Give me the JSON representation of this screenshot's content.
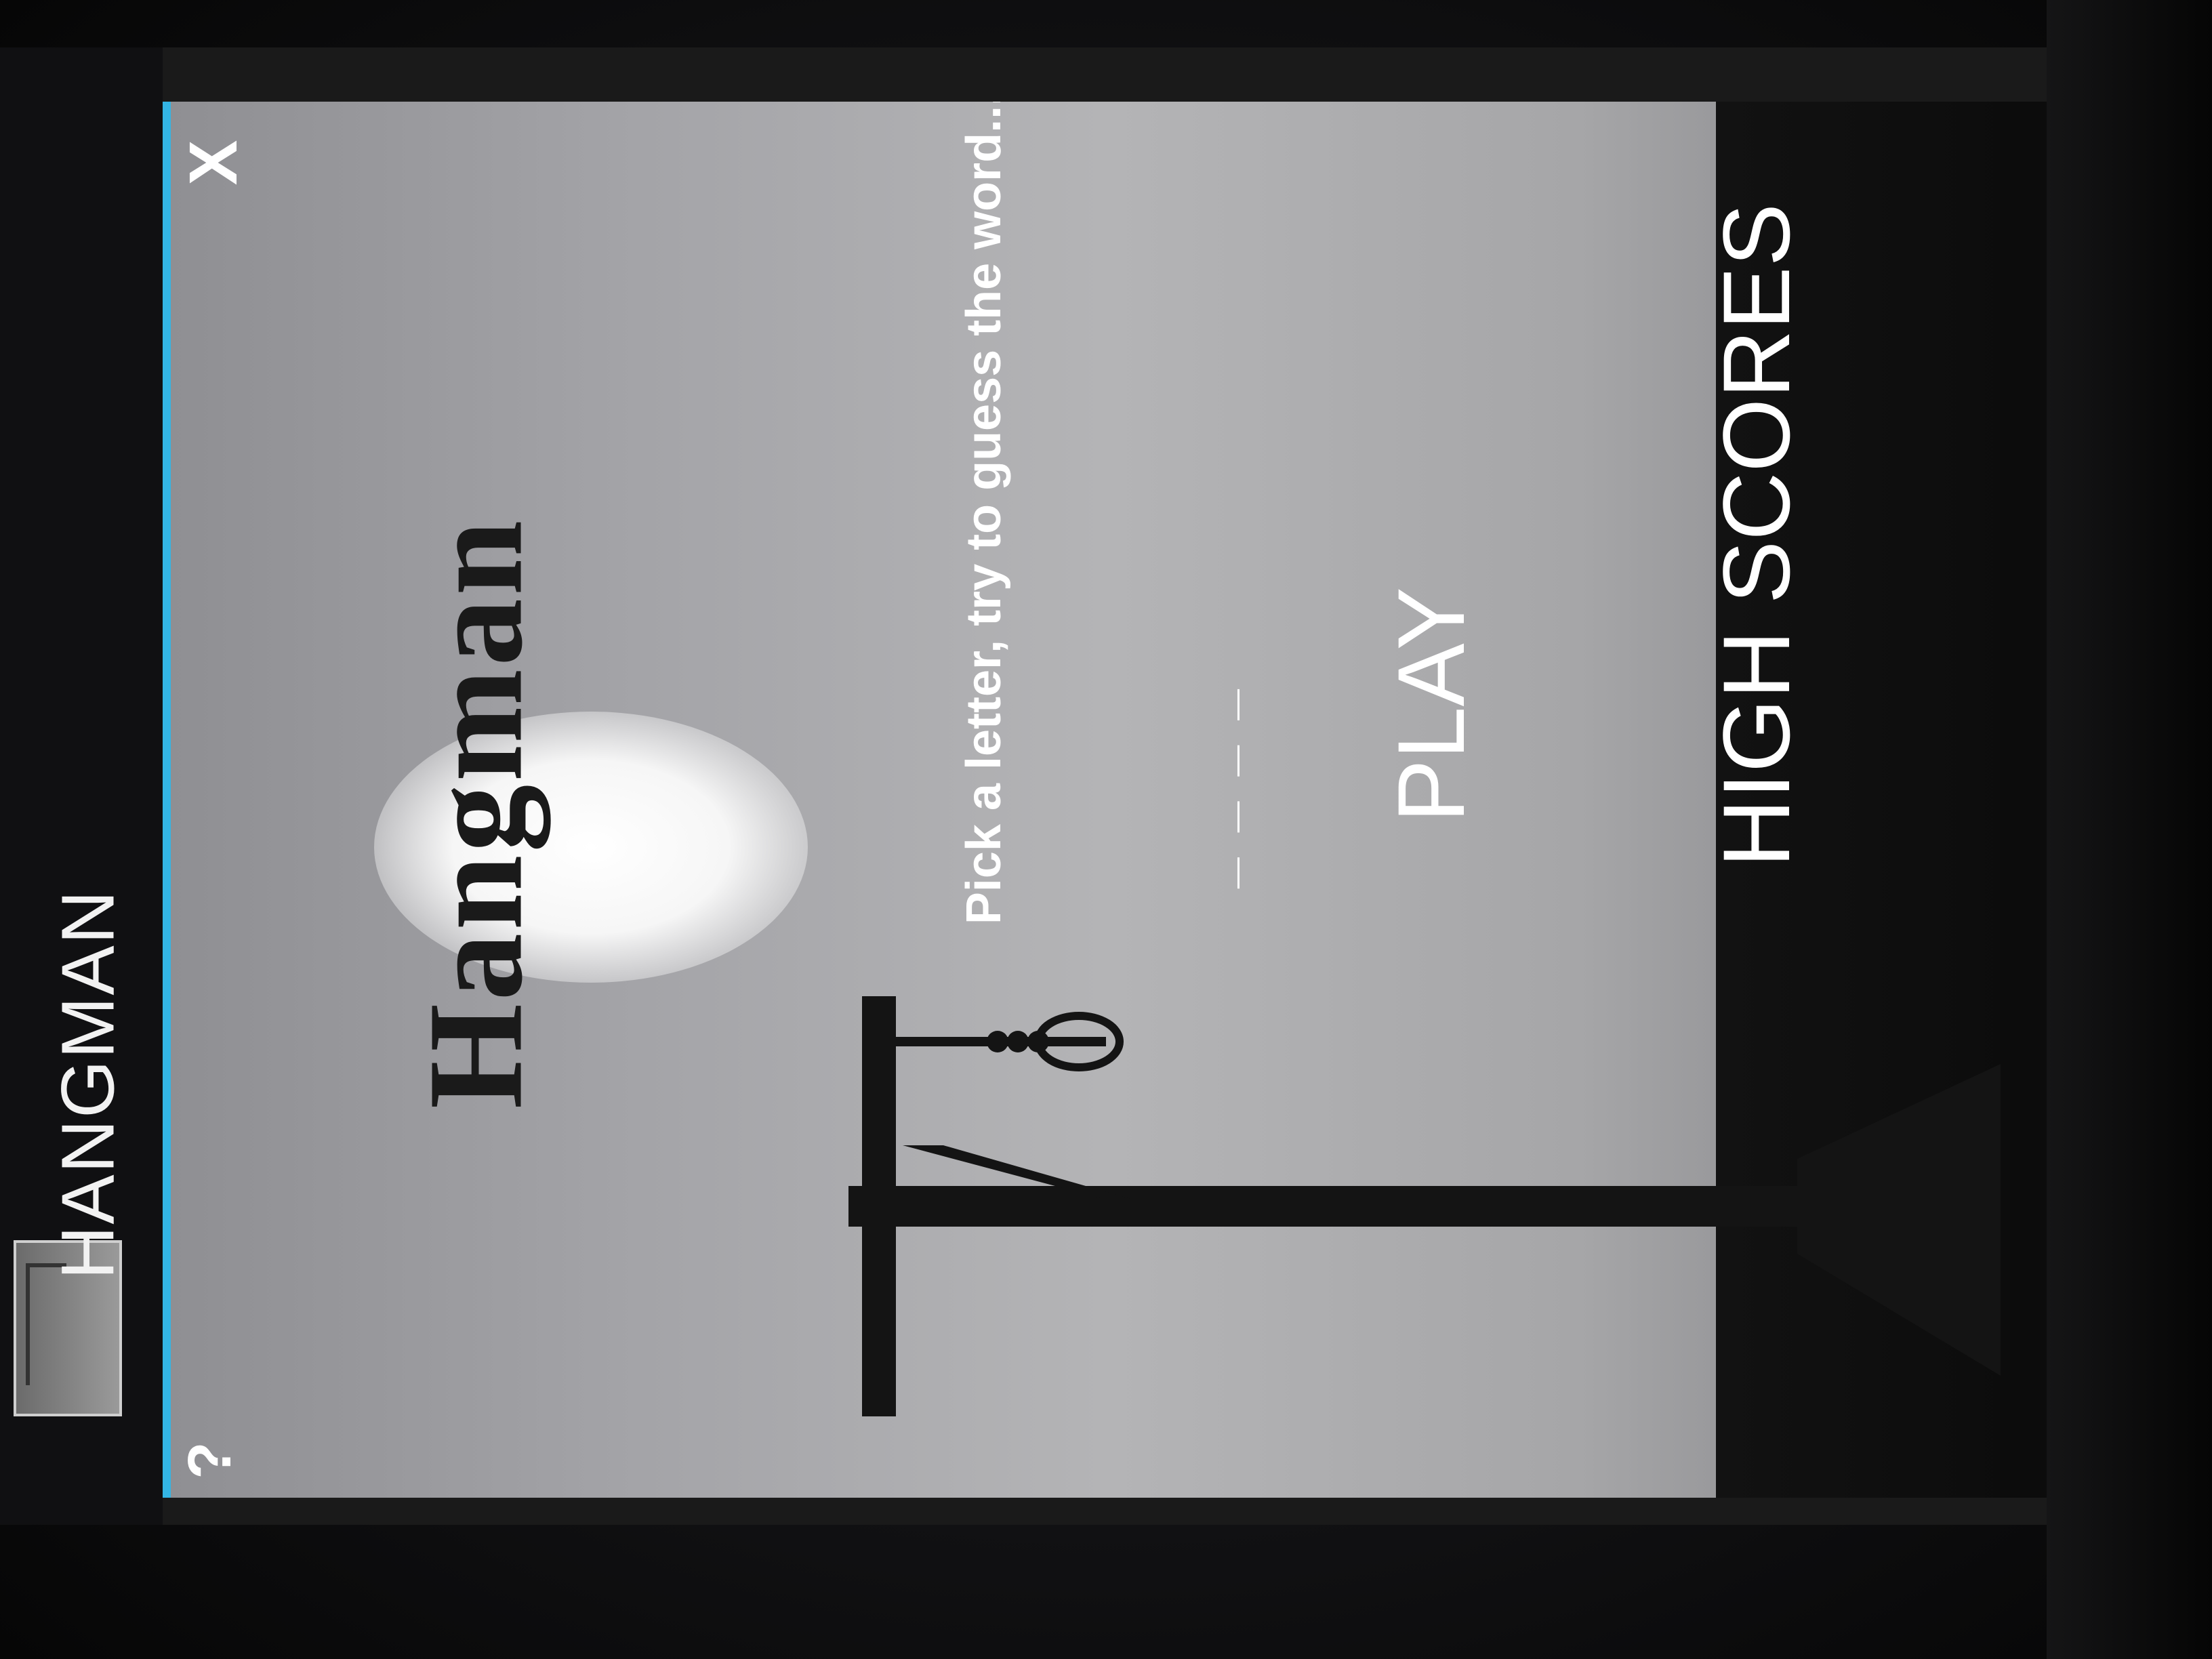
{
  "actionbar": {
    "title": "HANGMAN",
    "app_icon": "hangman-app-icon"
  },
  "controls": {
    "help_label": "?",
    "close_label": "X"
  },
  "game": {
    "logo_text": "Hangman",
    "instruction": "Pick a letter, try to guess the word...",
    "word_blanks": "_ _ _ _",
    "play_label": "PLAY",
    "high_scores_label": "HIGH SCORES"
  },
  "colors": {
    "accent": "#33b5e5",
    "sky": "#a4a4a8",
    "silhouette": "#141414",
    "text": "#ffffff"
  }
}
